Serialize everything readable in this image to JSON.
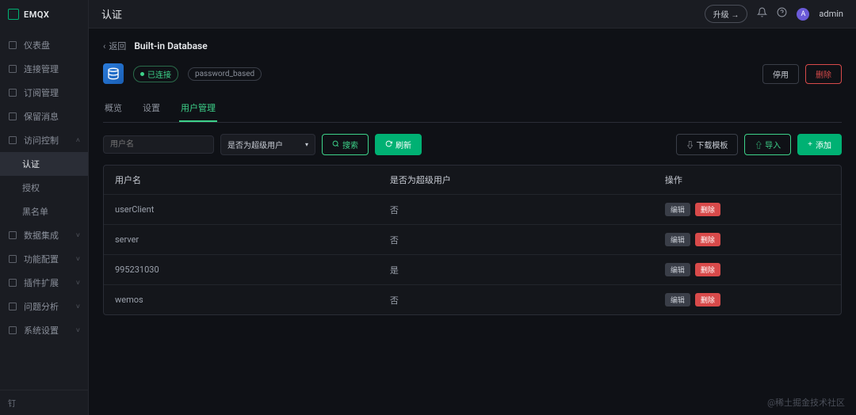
{
  "brand": "EMQX",
  "header": {
    "title": "认证",
    "upgrade": "升级 →",
    "username": "admin",
    "avatar_initial": "A"
  },
  "sidebar": {
    "items": [
      {
        "label": "仪表盘",
        "icon": "dashboard"
      },
      {
        "label": "连接管理",
        "icon": "connections"
      },
      {
        "label": "订阅管理",
        "icon": "subscriptions"
      },
      {
        "label": "保留消息",
        "icon": "retained"
      },
      {
        "label": "访问控制",
        "icon": "access",
        "expanded": true
      },
      {
        "label": "认证",
        "sub": true,
        "active": true
      },
      {
        "label": "授权",
        "sub": true
      },
      {
        "label": "黑名单",
        "sub": true
      },
      {
        "label": "数据集成",
        "icon": "integration",
        "chevron": true
      },
      {
        "label": "功能配置",
        "icon": "config",
        "chevron": true
      },
      {
        "label": "插件扩展",
        "icon": "plugins",
        "chevron": true
      },
      {
        "label": "问题分析",
        "icon": "analysis",
        "chevron": true
      },
      {
        "label": "系统设置",
        "icon": "settings",
        "chevron": true
      }
    ],
    "footer": "钉"
  },
  "breadcrumb": {
    "back": "返回",
    "title": "Built-in Database"
  },
  "status": {
    "label": "已连接",
    "mechanism": "password_based"
  },
  "actions": {
    "disable": "停用",
    "delete": "删除"
  },
  "tabs": [
    {
      "label": "概览"
    },
    {
      "label": "设置"
    },
    {
      "label": "用户管理",
      "active": true
    }
  ],
  "toolbar": {
    "search_placeholder": "用户名",
    "filter_label": "是否为超级用户",
    "search_btn": "搜索",
    "refresh_btn": "刷新",
    "download_btn": "下载模板",
    "import_btn": "导入",
    "add_btn": "添加"
  },
  "table": {
    "columns": [
      "用户名",
      "是否为超级用户",
      "操作"
    ],
    "edit_label": "编辑",
    "delete_label": "删除",
    "rows": [
      {
        "username": "userClient",
        "superuser": "否"
      },
      {
        "username": "server",
        "superuser": "否"
      },
      {
        "username": "995231030",
        "superuser": "是"
      },
      {
        "username": "wemos",
        "superuser": "否"
      }
    ]
  },
  "watermark": "@稀土掘金技术社区"
}
